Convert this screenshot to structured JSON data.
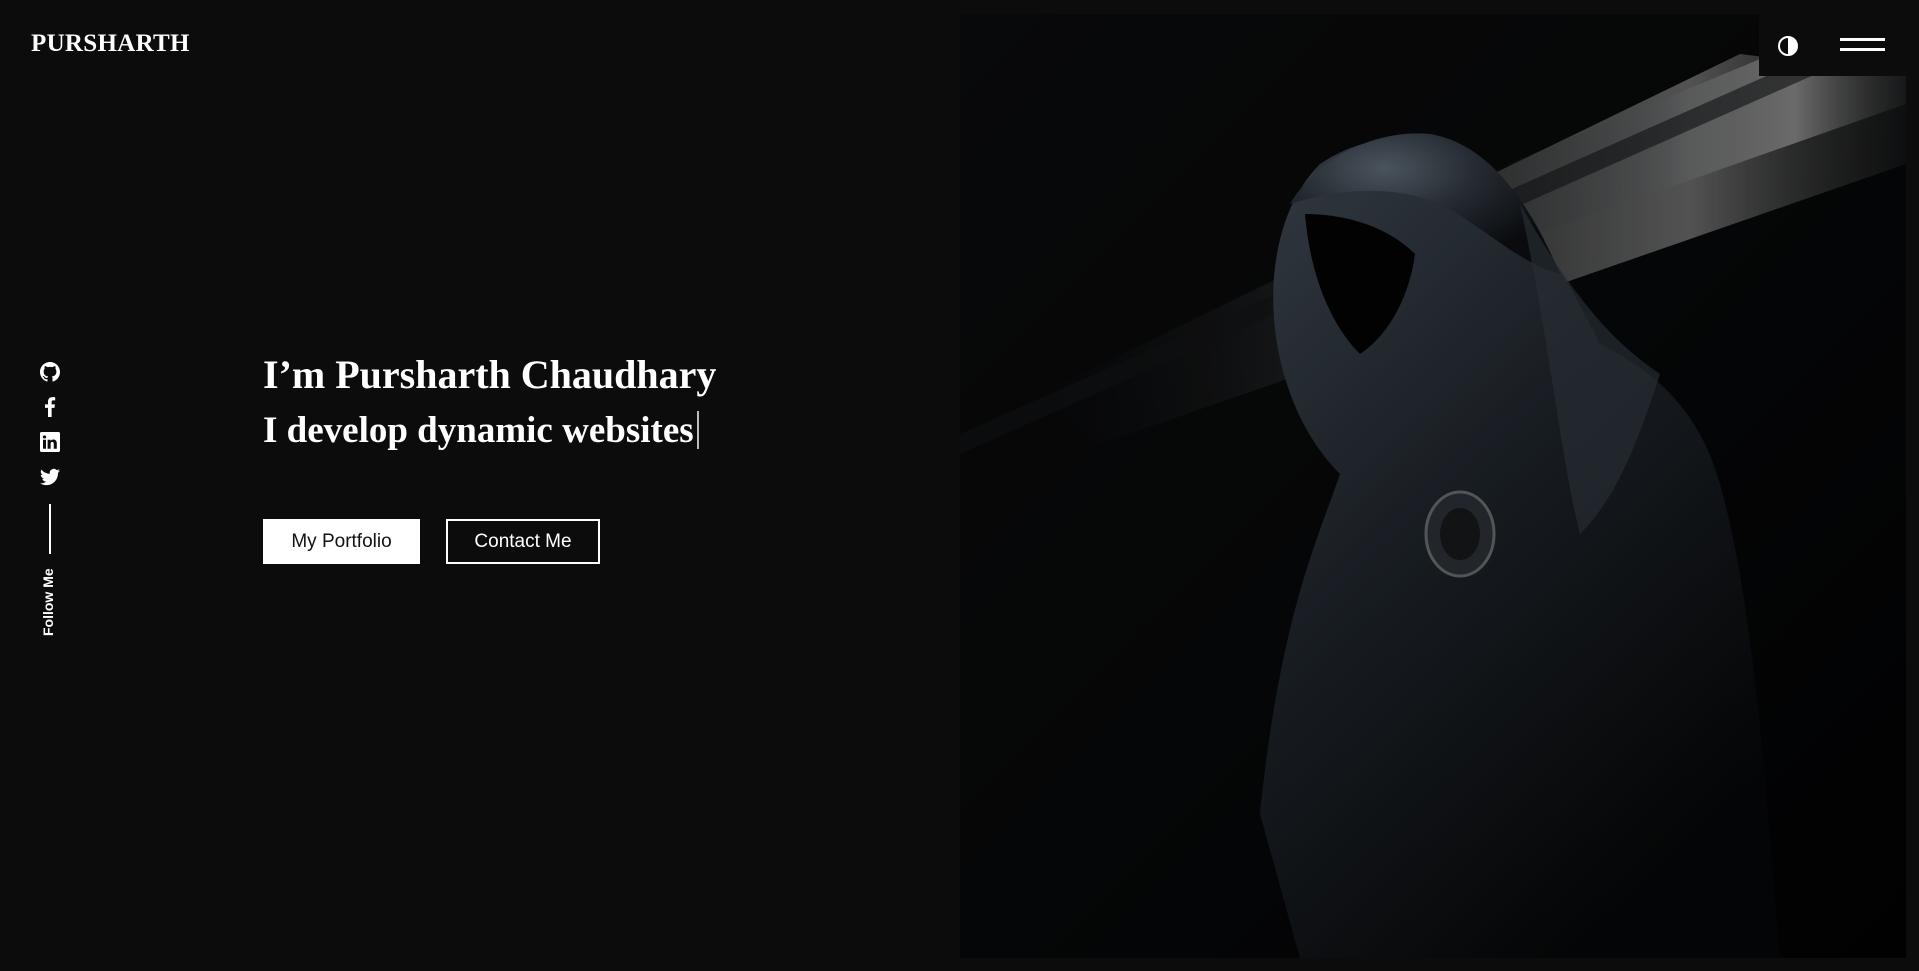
{
  "header": {
    "brand": "PURSHARTH"
  },
  "social": {
    "items": [
      "github-icon",
      "facebook-icon",
      "linkedin-icon",
      "twitter-icon"
    ],
    "follow_label": "Follow Me"
  },
  "hero": {
    "intro": "I’m Pursharth Chaudhary",
    "tagline": "I develop dynamic websites",
    "buttons": {
      "portfolio": "My Portfolio",
      "contact": "Contact Me"
    }
  },
  "controls": {
    "theme_icon": "contrast-icon",
    "menu_icon": "hamburger-menu-icon"
  },
  "colors": {
    "background": "#0c0c0c",
    "text": "#ffffff",
    "button_solid_bg": "#ffffff",
    "button_solid_text": "#111111"
  }
}
